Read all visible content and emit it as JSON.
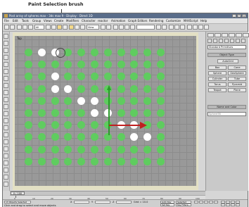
{
  "callout": {
    "text": "Paint Selection brush"
  },
  "window": {
    "title": "Post array of spheres.max - 3ds max 9 - Display : Direct 3D"
  },
  "menus": [
    "File",
    "Edit",
    "Tools",
    "Group",
    "Views",
    "Create",
    "Modifiers",
    "Character",
    "reactor",
    "Animation",
    "Graph Editors",
    "Rendering",
    "Customize",
    "MAXScript",
    "Help"
  ],
  "toolbar": {
    "view_dropdown": "View",
    "selection_set": ""
  },
  "viewport": {
    "label": "Top",
    "object_color": "#5fcc5f",
    "selected_color": "#ffffff",
    "background": "#999999"
  },
  "spheres": {
    "rows": 10,
    "cols": 11,
    "selected": [
      [
        0,
        1
      ],
      [
        0,
        2
      ],
      [
        2,
        2
      ],
      [
        3,
        2
      ],
      [
        3,
        3
      ],
      [
        4,
        4
      ],
      [
        4,
        5
      ],
      [
        5,
        5
      ],
      [
        5,
        6
      ],
      [
        6,
        7
      ],
      [
        6,
        8
      ],
      [
        7,
        8
      ],
      [
        7,
        9
      ]
    ]
  },
  "command_panel": {
    "dropdown": "Standard Primitives",
    "rollout_object_type": "Object Type",
    "autogrid": "AutoGrid",
    "buttons": [
      "Box",
      "Cone",
      "Sphere",
      "GeoSphere",
      "Cylinder",
      "Tube",
      "Torus",
      "Pyramid",
      "Teapot",
      "Plane"
    ],
    "rollout_name_color": "Name and Color",
    "name_value": "Sphere56"
  },
  "timeslider": {
    "label": "0 / 100"
  },
  "ticks": [
    "0",
    "10",
    "20",
    "30",
    "40",
    "50",
    "60",
    "70",
    "80",
    "90",
    "100"
  ],
  "status": {
    "objects": "13 Objects Selected",
    "hint": "Click and drag to select and move objects",
    "x_label": "X",
    "x_value": "",
    "y_label": "Y",
    "z_label": "Z",
    "grid": "Grid = 10.0",
    "autokey": "Auto Key",
    "selected": "Selected",
    "setkey": "Set Key",
    "keyfilters": "Key Filters..."
  }
}
